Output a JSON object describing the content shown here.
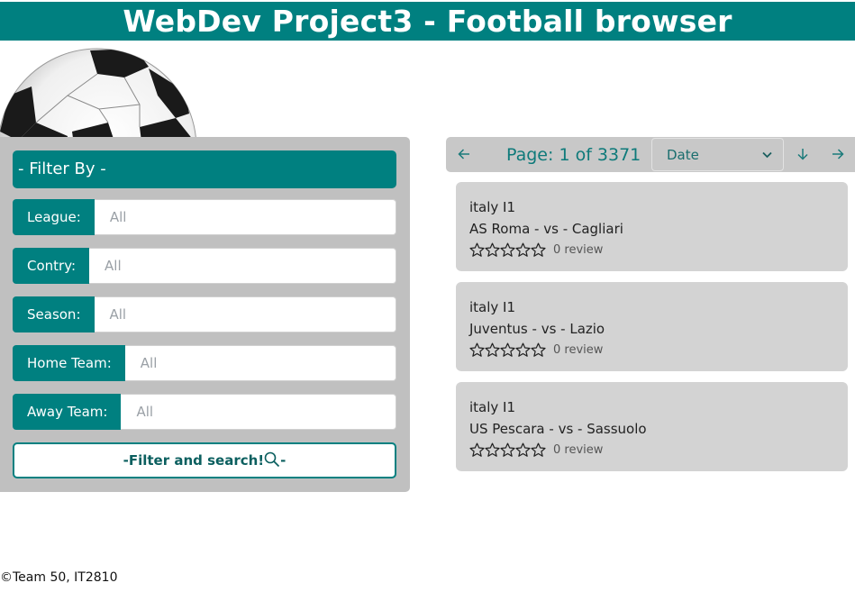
{
  "header": {
    "title": "WebDev Project3 - Football browser"
  },
  "filter": {
    "title": "- Filter By -",
    "fields": [
      {
        "label": "League:",
        "value": "All"
      },
      {
        "label": "Contry:",
        "value": "All"
      },
      {
        "label": "Season:",
        "value": "All"
      },
      {
        "label": "Home Team:",
        "value": "All"
      },
      {
        "label": "Away Team:",
        "value": "All"
      }
    ],
    "button_label": "-Filter and search!",
    "button_suffix": "-"
  },
  "pager": {
    "page_text": "Page: 1 of 3371",
    "sort_value": "Date"
  },
  "matches": [
    {
      "league": "italy I1",
      "teams": "AS Roma - vs - Cagliari",
      "reviews": "0 review",
      "rating": 0
    },
    {
      "league": "italy I1",
      "teams": "Juventus - vs - Lazio",
      "reviews": "0 review",
      "rating": 0
    },
    {
      "league": "italy I1",
      "teams": "US Pescara - vs - Sassuolo",
      "reviews": "0 review",
      "rating": 0
    }
  ],
  "footer": {
    "text": "©Team 50, IT2810"
  },
  "colors": {
    "accent": "#008080",
    "panel": "#c0c0c0",
    "card": "#d3d3d3"
  }
}
